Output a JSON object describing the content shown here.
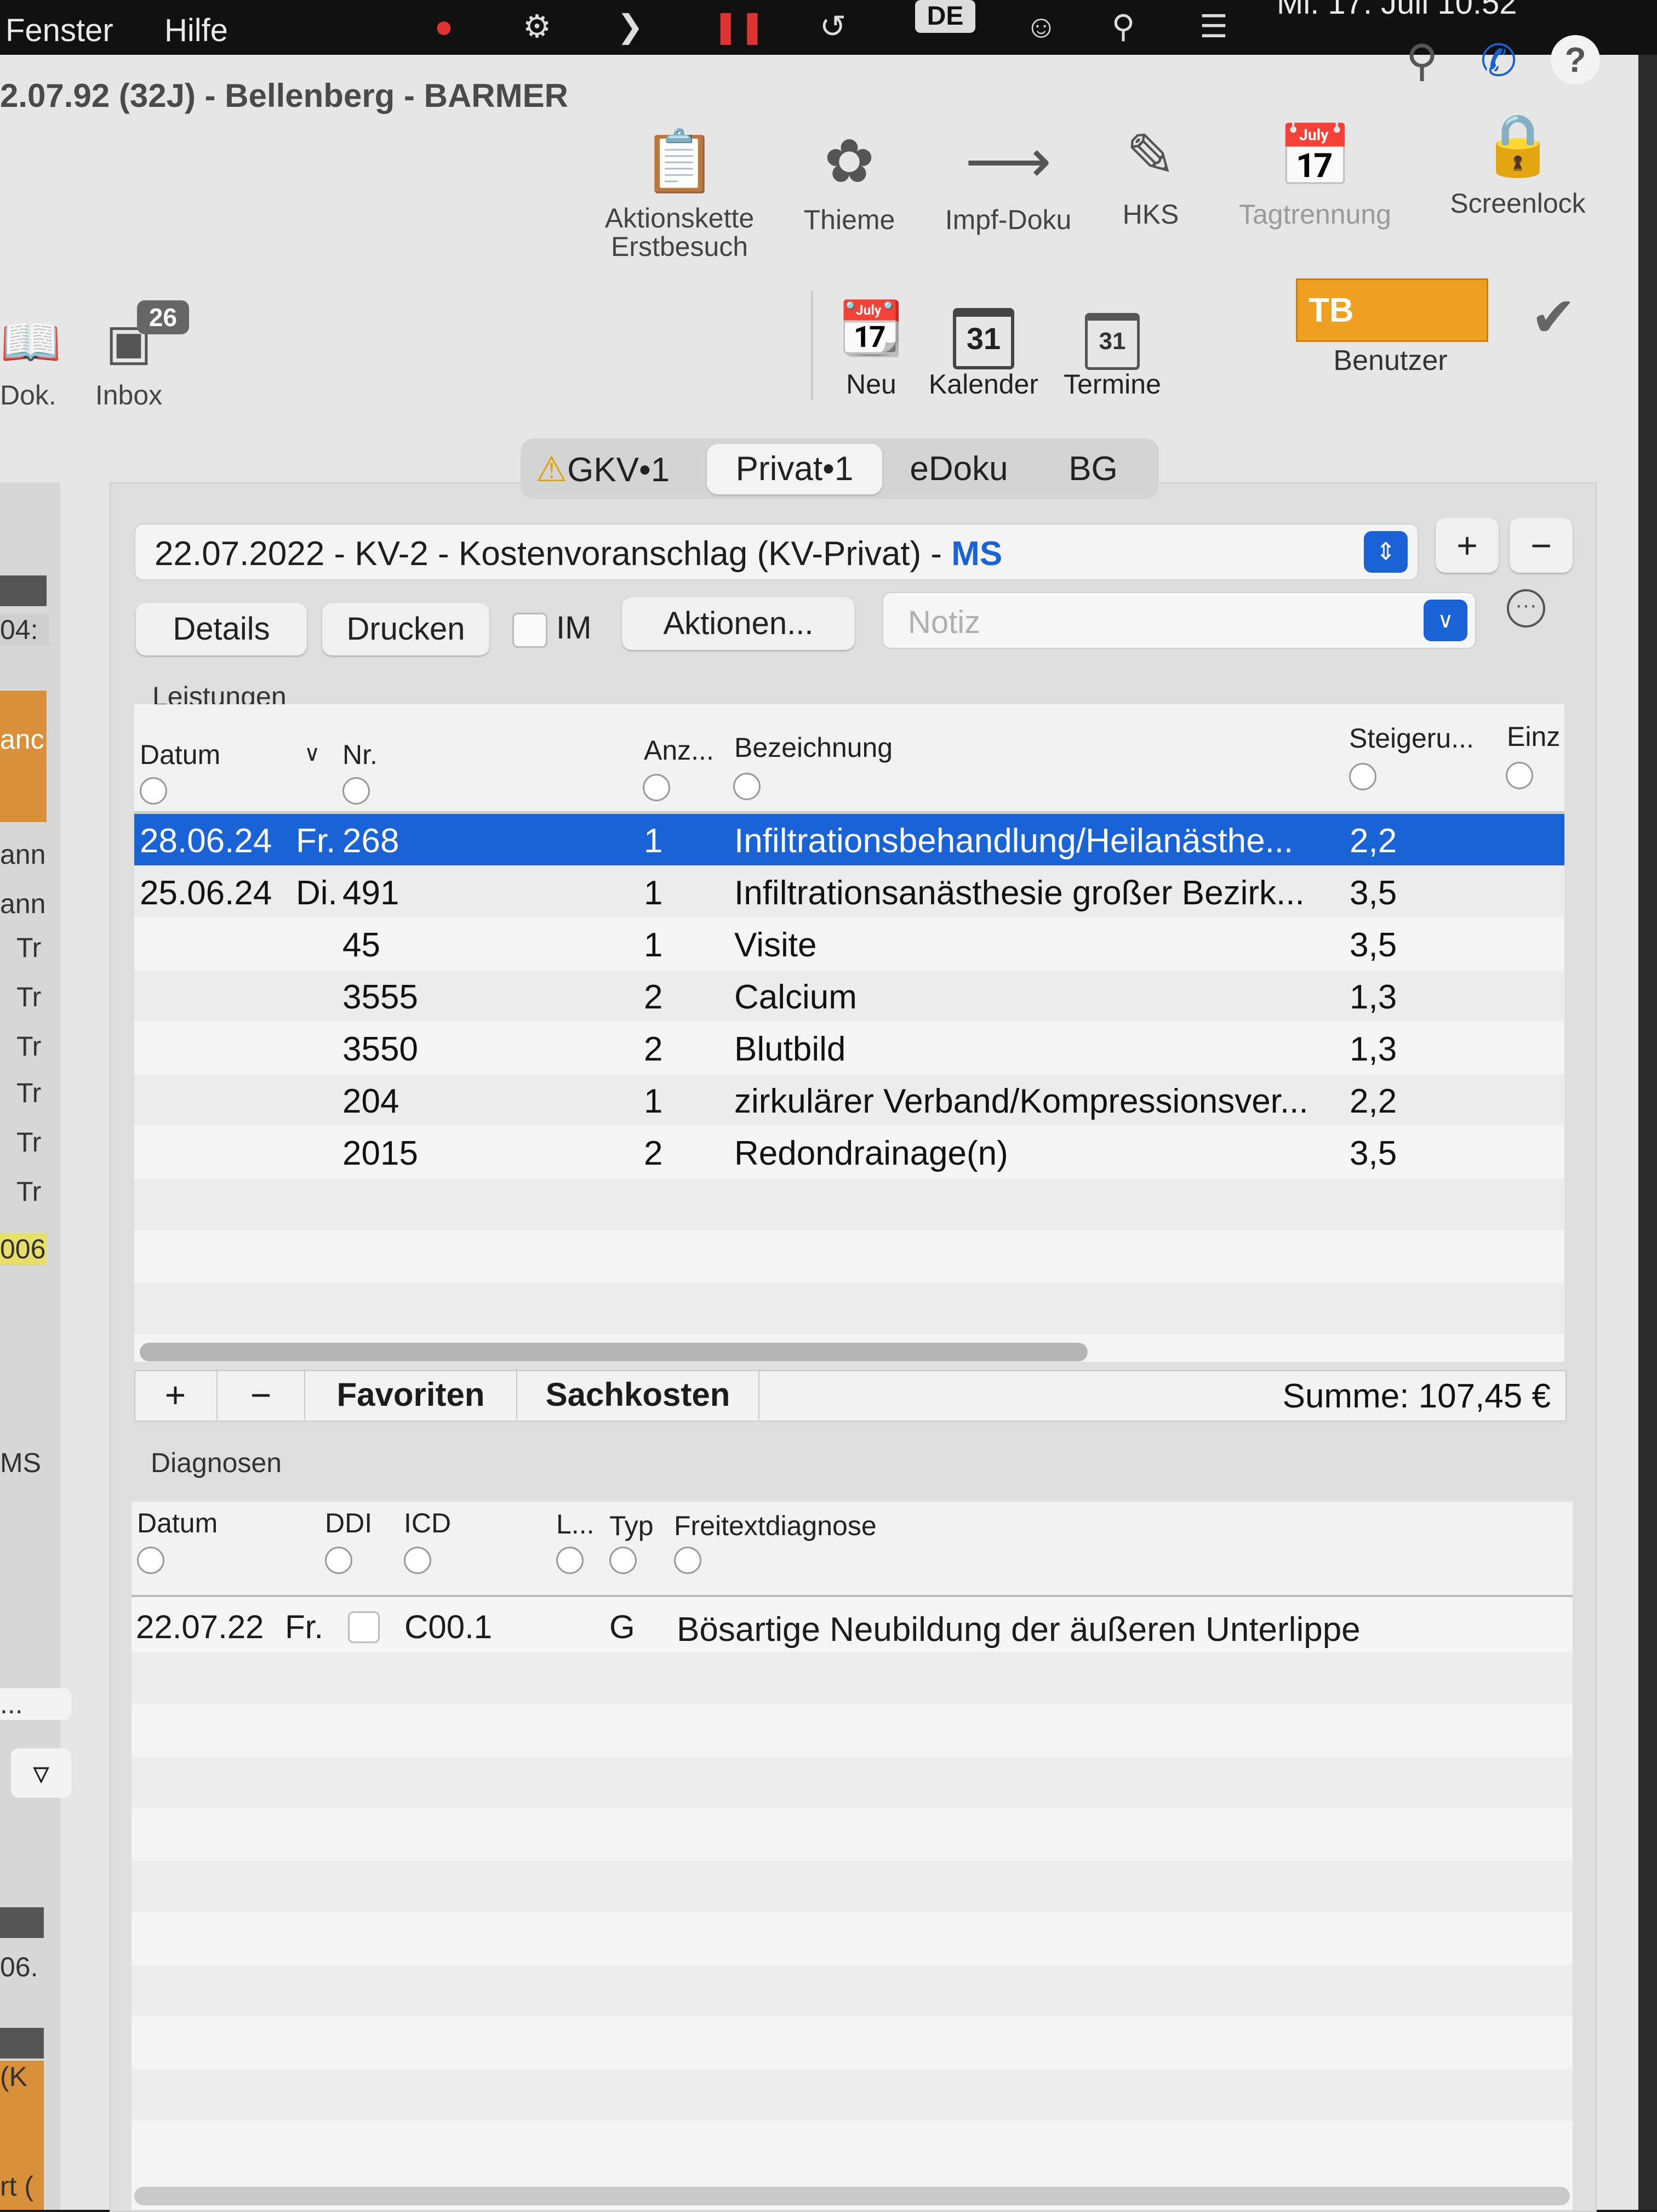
{
  "menubar": {
    "items": [
      "Fenster",
      "Hilfe"
    ],
    "input_source": "DE",
    "clock": "Mi. 17. Juli 10:52"
  },
  "window": {
    "title": "2.07.92 (32J) - Bellenberg - BARMER"
  },
  "toolbar": {
    "buttons": [
      {
        "label": "Aktionskette\nErstbesuch",
        "icon": "clipboard-icon"
      },
      {
        "label": "Thieme",
        "icon": "app-icon"
      },
      {
        "label": "Impf-Doku",
        "icon": "syringe-icon"
      },
      {
        "label": "HKS",
        "icon": "edit-doc-icon"
      },
      {
        "label": "Tagtrennung",
        "icon": "calendar-19-icon"
      },
      {
        "label": "Screenlock",
        "icon": "monitor-lock-icon"
      }
    ],
    "row2": {
      "dok": "Dok.",
      "inbox": "Inbox",
      "inbox_badge": "26",
      "neu": "Neu",
      "kalender": "Kalender",
      "kalender_day": "31",
      "termine": "Termine",
      "termine_day": "31",
      "user_initials": "TB",
      "benutzer": "Benutzer"
    }
  },
  "left_strip": [
    "04:",
    "anc",
    "ann",
    "ann",
    "Tr",
    "Tr",
    "Tr",
    "Tr",
    "Tr",
    "Tr",
    "006",
    "MS",
    "...",
    "06.",
    "(K",
    "rt ("
  ],
  "tabs": [
    {
      "label": "GKV•1",
      "warning": true
    },
    {
      "label": "Privat•1",
      "selected": true
    },
    {
      "label": "eDoku"
    },
    {
      "label": "BG"
    }
  ],
  "document_select": {
    "value": "22.07.2022 - KV-2 - Kostenvoranschlag (KV-Privat) - ",
    "value_suffix": "MS"
  },
  "actions": {
    "details": "Details",
    "drucken": "Drucken",
    "im": "IM",
    "aktionen": "Aktionen...",
    "notiz_placeholder": "Notiz"
  },
  "leistungen": {
    "section_label": "Leistungen",
    "columns": [
      "Datum",
      "Nr.",
      "Anz...",
      "Bezeichnung",
      "Steigeru...",
      "Einz"
    ],
    "rows": [
      {
        "datum": "28.06.24",
        "tag": "Fr.",
        "nr": "268",
        "anz": "1",
        "bez": "Infiltrationsbehandlung/Heilanästhe...",
        "steig": "2,2"
      },
      {
        "datum": "25.06.24",
        "tag": "Di.",
        "nr": "491",
        "anz": "1",
        "bez": "Infiltrationsanästhesie großer Bezirk...",
        "steig": "3,5"
      },
      {
        "datum": "",
        "tag": "",
        "nr": "45",
        "anz": "1",
        "bez": "Visite",
        "steig": "3,5"
      },
      {
        "datum": "",
        "tag": "",
        "nr": "3555",
        "anz": "2",
        "bez": "Calcium",
        "steig": "1,3"
      },
      {
        "datum": "",
        "tag": "",
        "nr": "3550",
        "anz": "2",
        "bez": "Blutbild",
        "steig": "1,3"
      },
      {
        "datum": "",
        "tag": "",
        "nr": "204",
        "anz": "1",
        "bez": "zirkulärer Verband/Kompressionsver...",
        "steig": "2,2"
      },
      {
        "datum": "",
        "tag": "",
        "nr": "2015",
        "anz": "2",
        "bez": "Redondrainage(n)",
        "steig": "3,5"
      }
    ],
    "footer": {
      "plus": "+",
      "minus": "−",
      "favoriten": "Favoriten",
      "sachkosten": "Sachkosten",
      "summe": "Summe: 107,45 €"
    }
  },
  "diagnosen": {
    "section_label": "Diagnosen",
    "columns": [
      "Datum",
      "DDI",
      "ICD",
      "L...",
      "Typ",
      "Freitextdiagnose"
    ],
    "rows": [
      {
        "datum": "22.07.22",
        "tag": "Fr.",
        "icd": "C00.1",
        "typ": "G",
        "text": "Bösartige Neubildung der äußeren Unterlippe"
      }
    ]
  }
}
